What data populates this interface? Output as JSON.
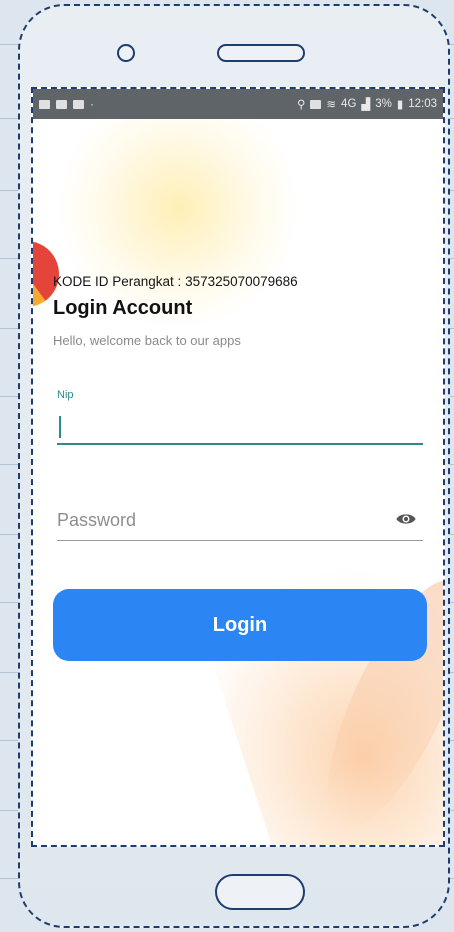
{
  "status_bar": {
    "time": "12:03",
    "battery": "3%",
    "signal": "4G"
  },
  "device": {
    "label": "KODE ID Perangkat : ",
    "id": "357325070079686"
  },
  "login": {
    "title": "Login Account",
    "subtitle": "Hello, welcome back to our apps",
    "nip_label": "Nip",
    "nip_value": "",
    "password_placeholder": "Password",
    "button_label": "Login"
  },
  "colors": {
    "accent": "#2b86f3",
    "field_focus": "#2e8a8a",
    "status_bar": "#5f6468"
  },
  "icons": [
    "show-password-eye-icon",
    "location-icon",
    "wifi-icon",
    "battery-icon"
  ]
}
